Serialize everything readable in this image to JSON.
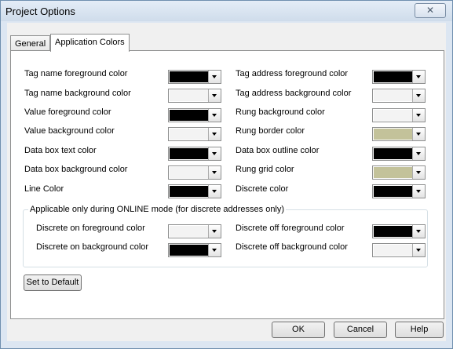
{
  "window": {
    "title": "Project Options",
    "close_glyph": "✕"
  },
  "tabs": [
    {
      "label": "General"
    },
    {
      "label": "Application Colors"
    }
  ],
  "colors": {
    "black": "#000000",
    "white": "#f3f3f3",
    "khaki": "#c3c29a"
  },
  "left_options": [
    {
      "label": "Tag name foreground color",
      "color": "#000000"
    },
    {
      "label": "Tag name background color",
      "color": "#f3f3f3"
    },
    {
      "label": "Value foreground color",
      "color": "#000000"
    },
    {
      "label": "Value background color",
      "color": "#f3f3f3"
    },
    {
      "label": "Data box text color",
      "color": "#000000"
    },
    {
      "label": "Data box background color",
      "color": "#f3f3f3"
    },
    {
      "label": "Line Color",
      "color": "#000000"
    }
  ],
  "right_options": [
    {
      "label": "Tag address foreground color",
      "color": "#000000"
    },
    {
      "label": "Tag address background color",
      "color": "#f3f3f3"
    },
    {
      "label": "Rung background color",
      "color": "#f3f3f3"
    },
    {
      "label": "Rung border color",
      "color": "#c3c29a"
    },
    {
      "label": "Data box outline color",
      "color": "#000000"
    },
    {
      "label": "Rung grid color",
      "color": "#c3c29a"
    },
    {
      "label": "Discrete color",
      "color": "#000000"
    }
  ],
  "online_group": {
    "title": "Applicable only during ONLINE mode (for discrete addresses only)",
    "left": [
      {
        "label": "Discrete on foreground color",
        "color": "#f3f3f3"
      },
      {
        "label": "Discrete on background color",
        "color": "#000000"
      }
    ],
    "right": [
      {
        "label": "Discrete off foreground color",
        "color": "#000000"
      },
      {
        "label": "Discrete off background color",
        "color": "#f3f3f3"
      }
    ]
  },
  "buttons": {
    "set_default": "Set to Default",
    "ok": "OK",
    "cancel": "Cancel",
    "help": "Help"
  }
}
